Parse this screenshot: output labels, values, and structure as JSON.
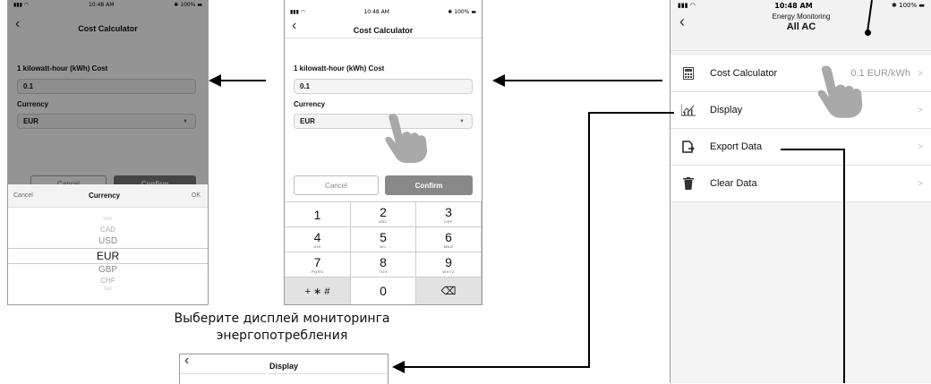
{
  "status": {
    "time": "10:48 AM",
    "battery": "100%",
    "bt": "✱"
  },
  "cost_calculator": {
    "title": "Cost Calculator",
    "kwh_label": "1 kilowatt-hour (kWh) Cost",
    "kwh_value": "0.1",
    "currency_label": "Currency",
    "currency_value": "EUR",
    "cancel": "Cancel",
    "confirm": "Confirm"
  },
  "picker": {
    "cancel": "Cancel",
    "title": "Currency",
    "ok": "OK",
    "options": [
      "DKK",
      "CAD",
      "USD",
      "EUR",
      "GBP",
      "CHF",
      "SEK"
    ],
    "selected": "EUR"
  },
  "keypad": {
    "keys": [
      {
        "main": "1",
        "sub": ""
      },
      {
        "main": "2",
        "sub": "ABC"
      },
      {
        "main": "3",
        "sub": "DEF"
      },
      {
        "main": "4",
        "sub": "GHI"
      },
      {
        "main": "5",
        "sub": "JKL"
      },
      {
        "main": "6",
        "sub": "MNO"
      },
      {
        "main": "7",
        "sub": "PQRS"
      },
      {
        "main": "8",
        "sub": "TUV"
      },
      {
        "main": "9",
        "sub": "WXYZ"
      },
      {
        "main": "+ ∗ #",
        "sub": ""
      },
      {
        "main": "0",
        "sub": ""
      },
      {
        "main": "⌫",
        "sub": ""
      }
    ]
  },
  "energy": {
    "subtitle": "Energy Monitoring",
    "title": "All AC",
    "items": [
      {
        "label": "Cost Calculator",
        "value": "0.1 EUR/kWh",
        "icon": "calculator-icon"
      },
      {
        "label": "Display",
        "value": "",
        "icon": "chart-icon"
      },
      {
        "label": "Export Data",
        "value": "",
        "icon": "export-icon"
      },
      {
        "label": "Clear Data",
        "value": "",
        "icon": "trash-icon"
      }
    ]
  },
  "caption": {
    "line1": "Выберите дисплей мониторинга",
    "line2": "энергопотребления"
  },
  "display_screen": {
    "title": "Display"
  },
  "chevron": ">"
}
